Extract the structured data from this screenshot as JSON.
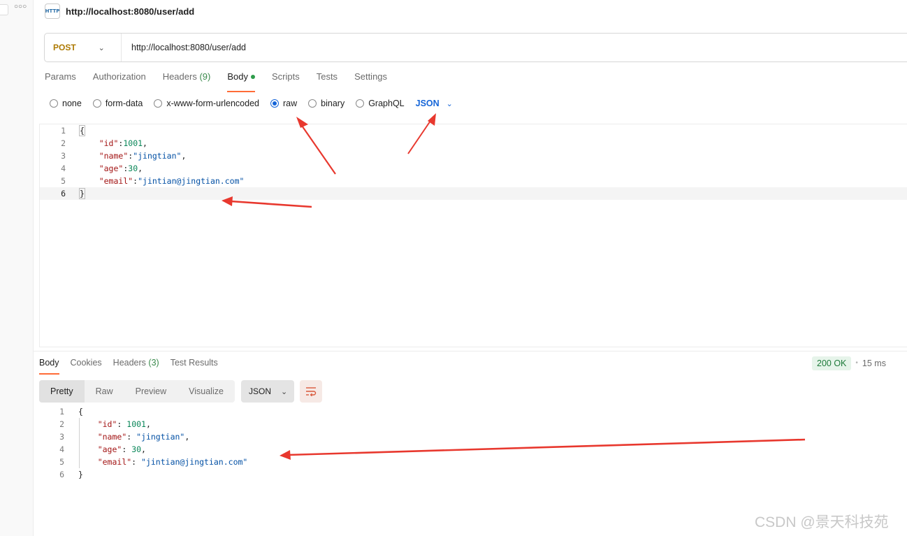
{
  "tab": {
    "icon": "http-icon",
    "icon_text": "HTTP",
    "title": "http://localhost:8080/user/add"
  },
  "request": {
    "method": "POST",
    "url": "http://localhost:8080/user/add",
    "tabs": [
      {
        "label": "Params"
      },
      {
        "label": "Authorization"
      },
      {
        "label": "Headers",
        "count": "(9)"
      },
      {
        "label": "Body",
        "active": true,
        "indicator": "green-dot"
      },
      {
        "label": "Scripts"
      },
      {
        "label": "Tests"
      },
      {
        "label": "Settings"
      }
    ],
    "body_modes": [
      "none",
      "form-data",
      "x-www-form-urlencoded",
      "raw",
      "binary",
      "GraphQL"
    ],
    "body_mode_selected": "raw",
    "raw_format": "JSON",
    "editor_lines": [
      "1",
      "2",
      "3",
      "4",
      "5",
      "6"
    ],
    "editor_code": {
      "open": "{",
      "id_key": "\"id\"",
      "id_val": "1001",
      "name_key": "\"name\"",
      "name_val": "\"jingtian\"",
      "age_key": "\"age\"",
      "age_val": "30",
      "email_key": "\"email\"",
      "email_val": "\"jintian@jingtian.com\"",
      "close": "}"
    }
  },
  "response": {
    "tabs": [
      {
        "label": "Body",
        "active": true
      },
      {
        "label": "Cookies"
      },
      {
        "label": "Headers",
        "count": "(3)"
      },
      {
        "label": "Test Results"
      }
    ],
    "status": "200 OK",
    "status_color": "#1e7a3a",
    "time": "15 ms",
    "views": [
      "Pretty",
      "Raw",
      "Preview",
      "Visualize"
    ],
    "view_selected": "Pretty",
    "format": "JSON",
    "wrap_icon": "wrap-lines-icon",
    "editor_lines": [
      "1",
      "2",
      "3",
      "4",
      "5",
      "6"
    ],
    "editor_code": {
      "open": "{",
      "id_key": "\"id\"",
      "id_val": "1001",
      "name_key": "\"name\"",
      "name_val": "\"jingtian\"",
      "age_key": "\"age\"",
      "age_val": "30",
      "email_key": "\"email\"",
      "email_val": "\"jintian@jingtian.com\"",
      "close": "}"
    }
  },
  "annotation_color": "#e8382e",
  "watermark": "CSDN @景天科技苑"
}
